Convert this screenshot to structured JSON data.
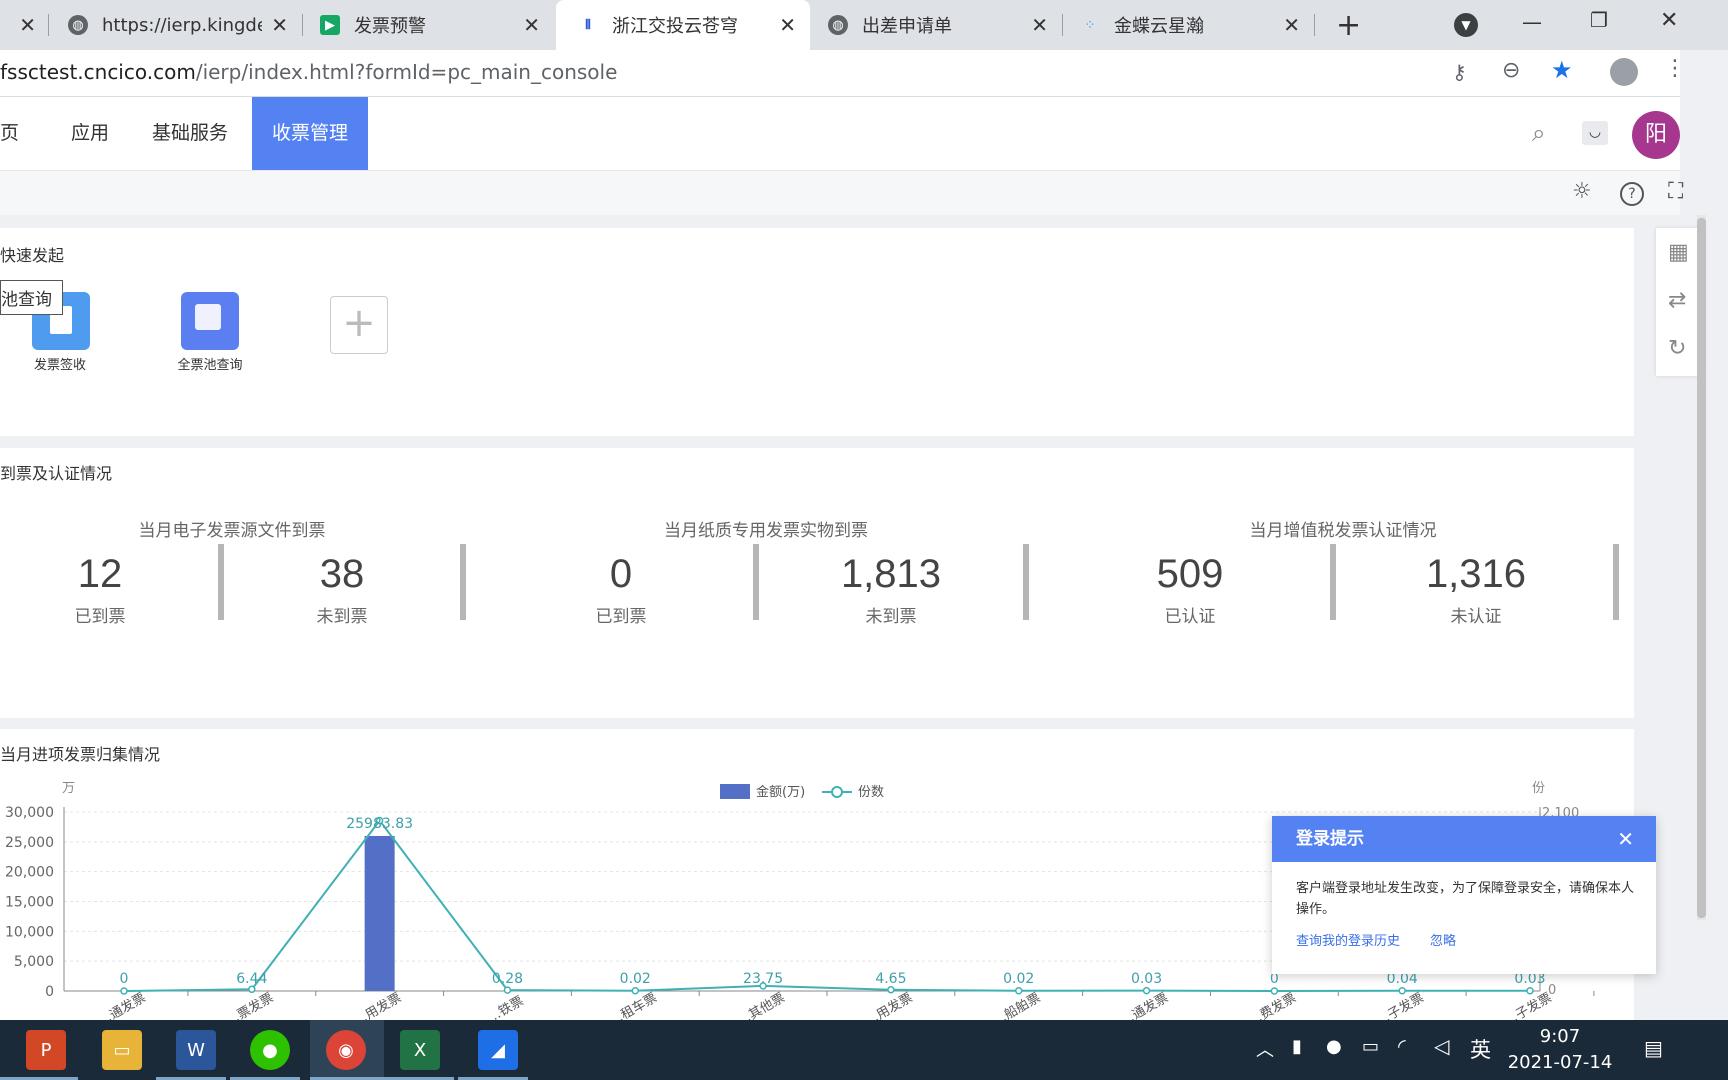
{
  "browser": {
    "tabs": [
      {
        "label": "https://ierp.kingde",
        "favicon": "globe-icon"
      },
      {
        "label": "发票预警",
        "favicon": "play-icon"
      },
      {
        "label": "浙江交投云苍穹",
        "favicon": "app-icon"
      },
      {
        "label": "出差申请单",
        "favicon": "globe-icon"
      },
      {
        "label": "金蝶云星瀚",
        "favicon": "kingdee-icon"
      }
    ],
    "new_tab": "+",
    "address": {
      "host": "fssctest.cncico.com",
      "path": "/ierp/index.html?formId=pc_main_console"
    }
  },
  "nav": {
    "items": [
      "首页",
      "应用",
      "基础服务",
      "收票管理"
    ],
    "visible_first": "页",
    "active_index": 3,
    "avatar_text": "阳",
    "avatar_color": "#a6378f",
    "accent": "#5582f3"
  },
  "quick": {
    "title": "快速发起",
    "tooltip": "池查询",
    "items": [
      {
        "label": "发票签收",
        "icon": "invoice-sign-icon"
      },
      {
        "label": "全票池查询",
        "icon": "invoice-pool-icon"
      }
    ]
  },
  "arrival": {
    "title": "到票及认证情况",
    "groups": [
      {
        "title": "当月电子发票源文件到票",
        "stats": [
          {
            "value": "12",
            "label": "已到票"
          },
          {
            "value": "38",
            "label": "未到票"
          }
        ]
      },
      {
        "title": "当月纸质专用发票实物到票",
        "stats": [
          {
            "value": "0",
            "label": "已到票"
          },
          {
            "value": "1,813",
            "label": "未到票"
          }
        ]
      },
      {
        "title": "当月增值税发票认证情况",
        "stats": [
          {
            "value": "509",
            "label": "已认证"
          },
          {
            "value": "1,316",
            "label": "未认证"
          }
        ]
      }
    ]
  },
  "collect": {
    "title": "当月进项发票归集情况",
    "yunit_left": "万",
    "yunit_right": "份",
    "right_tick_top": "2,100",
    "right_tick_zero": "0",
    "legend": {
      "bar": "金额(万)",
      "line": "份数"
    }
  },
  "chart_data": {
    "type": "bar",
    "title": "当月进项发票归集情况",
    "ylim": [
      0,
      30000
    ],
    "yticks": [
      "30,000",
      "25,000",
      "20,000",
      "15,000",
      "10,000",
      "5,000",
      "0"
    ],
    "categories": [
      "…通发票",
      "…票发票",
      "…用发票",
      "…铁票",
      "…租车票",
      "…其他票",
      "…用发票",
      "…船舶票",
      "…通发票",
      "…费发票",
      "…子发票",
      "…子发票"
    ],
    "series": [
      {
        "name": "金额(万)",
        "values": [
          0,
          6.44,
          25983.83,
          0.28,
          0.02,
          23.75,
          4.65,
          0.02,
          0.03,
          0,
          0.04,
          0.03
        ],
        "labels": [
          "0",
          "6.44",
          "25983.83",
          "0.28",
          "0.02",
          "23.75",
          "4.65",
          "0.02",
          "0.03",
          "0",
          "0.04",
          "0.03"
        ],
        "color": "#5470c6"
      },
      {
        "name": "份数",
        "values": [
          0,
          20,
          2000,
          10,
          3,
          60,
          15,
          3,
          4,
          0,
          3,
          3
        ],
        "color": "#3fb1b4"
      }
    ]
  },
  "popup": {
    "title": "登录提示",
    "close": "✕",
    "message": "客户端登录地址发生改变，为了保障登录安全，请确保本人操作。",
    "links": [
      "查询我的登录历史",
      "忽略"
    ]
  },
  "taskbar": {
    "ime": "英",
    "time": "9:07",
    "date": "2021-07-14"
  }
}
